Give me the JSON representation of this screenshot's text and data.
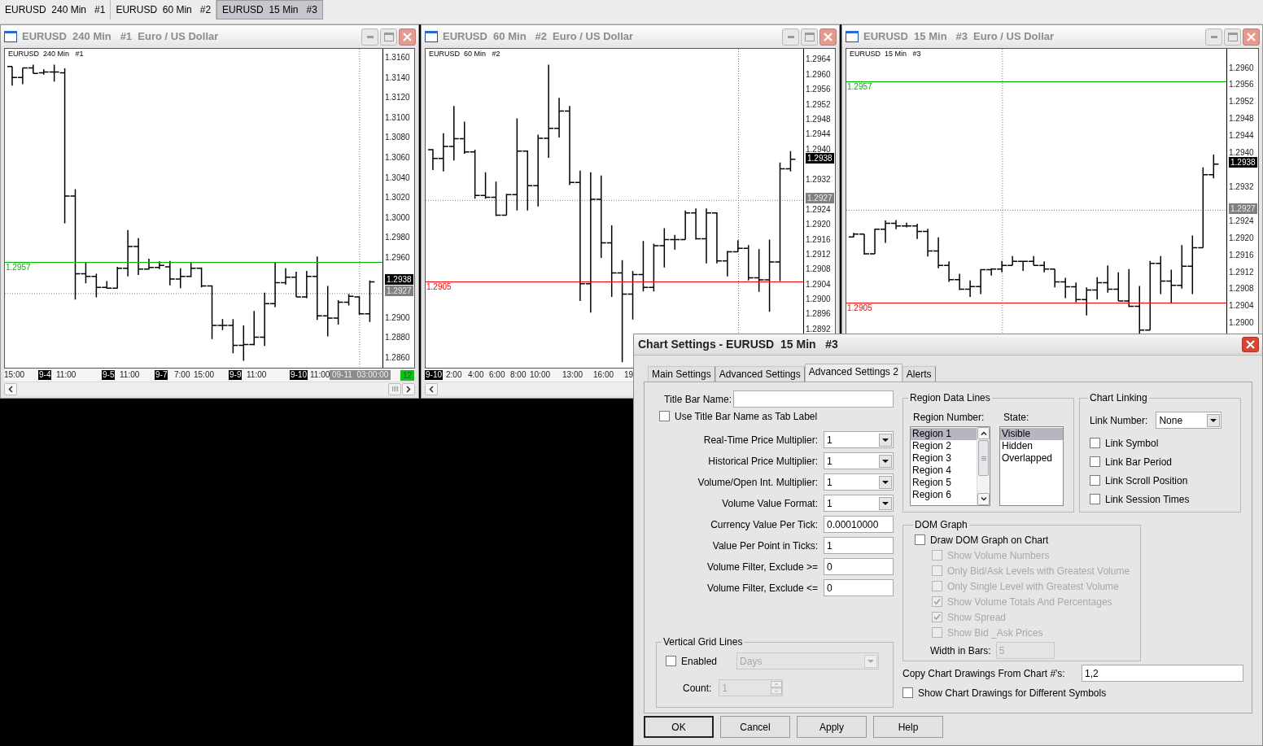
{
  "top_tabs": [
    {
      "label": "EURUSD  240 Min   #1",
      "selected": false
    },
    {
      "label": "EURUSD  60 Min   #2",
      "selected": false
    },
    {
      "label": "EURUSD  15 Min   #3",
      "selected": true
    }
  ],
  "windows": [
    {
      "title": "EURUSD  240 Min   #1  Euro / US Dollar",
      "chart_label": "EURUSD  240 Min   #1",
      "price_axis": [
        {
          "kind": "tick",
          "text": "1.3160"
        },
        {
          "kind": "tick",
          "text": "1.3140"
        },
        {
          "kind": "tick",
          "text": "1.3120"
        },
        {
          "kind": "tick",
          "text": "1.3100"
        },
        {
          "kind": "tick",
          "text": "1.3080"
        },
        {
          "kind": "tick",
          "text": "1.3060"
        },
        {
          "kind": "tick",
          "text": "1.3040"
        },
        {
          "kind": "tick",
          "text": "1.3020"
        },
        {
          "kind": "tick",
          "text": "1.3000"
        },
        {
          "kind": "tick",
          "text": "1.2980"
        },
        {
          "kind": "tick",
          "text": "1.2960"
        },
        {
          "kind": "last",
          "text": "1.2938"
        },
        {
          "kind": "cursor",
          "text": "1.2927"
        },
        {
          "kind": "tick",
          "text": "1.2900"
        },
        {
          "kind": "tick",
          "text": "1.2880"
        },
        {
          "kind": "tick",
          "text": "1.2860"
        }
      ],
      "level_lines": [
        {
          "price": "1.2957",
          "color": "#00b400"
        }
      ],
      "time_axis": [
        {
          "kind": "time",
          "text": "15:00"
        },
        {
          "kind": "date",
          "text": "9-4"
        },
        {
          "kind": "time",
          "text": "11:00"
        },
        {
          "kind": "date",
          "text": "9-5"
        },
        {
          "kind": "time",
          "text": "11:00"
        },
        {
          "kind": "date",
          "text": "9-7"
        },
        {
          "kind": "time",
          "text": "7:00"
        },
        {
          "kind": "time",
          "text": "15:00"
        },
        {
          "kind": "date",
          "text": "9-9"
        },
        {
          "kind": "time",
          "text": "11:00"
        },
        {
          "kind": "date",
          "text": "9-10"
        },
        {
          "kind": "time",
          "text": "11:00"
        },
        {
          "kind": "cursor",
          "text": "09-11  03:00:00"
        }
      ],
      "bar_counter": "12"
    },
    {
      "title": "EURUSD  60 Min   #2  Euro / US Dollar",
      "chart_label": "EURUSD  60 Min   #2",
      "price_axis": [
        {
          "kind": "tick",
          "text": "1.2964"
        },
        {
          "kind": "tick",
          "text": "1.2960"
        },
        {
          "kind": "tick",
          "text": "1.2956"
        },
        {
          "kind": "tick",
          "text": "1.2952"
        },
        {
          "kind": "tick",
          "text": "1.2948"
        },
        {
          "kind": "tick",
          "text": "1.2944"
        },
        {
          "kind": "tick",
          "text": "1.2940"
        },
        {
          "kind": "last",
          "text": "1.2938"
        },
        {
          "kind": "tick",
          "text": "1.2932"
        },
        {
          "kind": "cursor",
          "text": "1.2927"
        },
        {
          "kind": "tick",
          "text": "1.2924"
        },
        {
          "kind": "tick",
          "text": "1.2920"
        },
        {
          "kind": "tick",
          "text": "1.2916"
        },
        {
          "kind": "tick",
          "text": "1.2912"
        },
        {
          "kind": "tick",
          "text": "1.2908"
        },
        {
          "kind": "tick",
          "text": "1.2904"
        },
        {
          "kind": "tick",
          "text": "1.2900"
        },
        {
          "kind": "tick",
          "text": "1.2896"
        },
        {
          "kind": "tick",
          "text": "1.2892"
        }
      ],
      "level_lines": [
        {
          "price": "1.2905",
          "color": "#ff0000"
        }
      ],
      "time_axis": [
        {
          "kind": "date",
          "text": "9-10"
        },
        {
          "kind": "time",
          "text": "2:00"
        },
        {
          "kind": "time",
          "text": "4:00"
        },
        {
          "kind": "time",
          "text": "6:00"
        },
        {
          "kind": "time",
          "text": "8:00"
        },
        {
          "kind": "time",
          "text": "10:00"
        },
        {
          "kind": "time",
          "text": "13:00"
        },
        {
          "kind": "time",
          "text": "16:00"
        },
        {
          "kind": "time",
          "text": "19"
        }
      ]
    },
    {
      "title": "EURUSD  15 Min   #3  Euro / US Dollar",
      "chart_label": "EURUSD  15 Min   #3",
      "price_axis": [
        {
          "kind": "tick",
          "text": "1.2960"
        },
        {
          "kind": "tick",
          "text": "1.2956"
        },
        {
          "kind": "tick",
          "text": "1.2952"
        },
        {
          "kind": "tick",
          "text": "1.2948"
        },
        {
          "kind": "tick",
          "text": "1.2944"
        },
        {
          "kind": "tick",
          "text": "1.2940"
        },
        {
          "kind": "last",
          "text": "1.2938"
        },
        {
          "kind": "tick",
          "text": "1.2932"
        },
        {
          "kind": "cursor",
          "text": "1.2927"
        },
        {
          "kind": "tick",
          "text": "1.2924"
        },
        {
          "kind": "tick",
          "text": "1.2920"
        },
        {
          "kind": "tick",
          "text": "1.2916"
        },
        {
          "kind": "tick",
          "text": "1.2912"
        },
        {
          "kind": "tick",
          "text": "1.2908"
        },
        {
          "kind": "tick",
          "text": "1.2904"
        },
        {
          "kind": "tick",
          "text": "1.2900"
        }
      ],
      "level_lines": [
        {
          "price": "1.2957",
          "color": "#00b400"
        },
        {
          "price": "1.2905",
          "color": "#ff0000"
        }
      ]
    }
  ],
  "dialog": {
    "title": "Chart Settings - EURUSD  15 Min   #3",
    "tabs": [
      {
        "label": "Main Settings",
        "selected": false
      },
      {
        "label": "Advanced Settings",
        "selected": false
      },
      {
        "label": "Advanced Settings 2",
        "selected": true
      },
      {
        "label": "Alerts",
        "selected": false
      }
    ],
    "title_bar_name": {
      "label": "Title Bar Name:"
    },
    "use_title_as_tab": {
      "label": "Use Title Bar Name as Tab Label",
      "checked": false
    },
    "settings": [
      {
        "label": "Real-Time Price Multiplier:",
        "value": "1",
        "kind": "dropdown"
      },
      {
        "label": "Historical Price Multiplier:",
        "value": "1",
        "kind": "dropdown"
      },
      {
        "label": "Volume/Open Int. Multiplier:",
        "value": "1",
        "kind": "dropdown"
      },
      {
        "label": "Volume Value Format:",
        "value": "1",
        "kind": "dropdown"
      },
      {
        "label": "Currency Value Per Tick:",
        "value": "0.00010000",
        "kind": "text"
      },
      {
        "label": "Value Per Point in Ticks:",
        "value": "1",
        "kind": "text"
      },
      {
        "label": "Volume Filter, Exclude >=",
        "value": "0",
        "kind": "text"
      },
      {
        "label": "Volume Filter, Exclude <=",
        "value": "0",
        "kind": "text"
      }
    ],
    "vertical_grid_lines": {
      "title": "Vertical Grid Lines",
      "enabled": {
        "label": "Enabled",
        "checked": false
      },
      "unit": {
        "value": "Days",
        "disabled": true
      },
      "count": {
        "label": "Count:",
        "value": "1",
        "disabled": true
      }
    },
    "region_data_lines": {
      "title": "Region Data Lines",
      "region_label": "Region Number:",
      "state_label": "State:",
      "regions": [
        {
          "label": "Region 1",
          "selected": true
        },
        {
          "label": "Region 2",
          "selected": false
        },
        {
          "label": "Region 3",
          "selected": false
        },
        {
          "label": "Region 4",
          "selected": false
        },
        {
          "label": "Region 5",
          "selected": false
        },
        {
          "label": "Region 6",
          "selected": false
        }
      ],
      "states": [
        {
          "label": "Visible",
          "selected": true
        },
        {
          "label": "Hidden",
          "selected": false
        },
        {
          "label": "Overlapped",
          "selected": false
        }
      ]
    },
    "chart_linking": {
      "title": "Chart Linking",
      "link_number": {
        "label": "Link Number:",
        "value": "None"
      },
      "options": [
        {
          "label": "Link Symbol",
          "checked": false
        },
        {
          "label": "Link Bar Period",
          "checked": false
        },
        {
          "label": "Link Scroll Position",
          "checked": false
        },
        {
          "label": "Link Session Times",
          "checked": false
        }
      ]
    },
    "dom_graph": {
      "title": "DOM Graph",
      "draw": {
        "label": "Draw DOM Graph on Chart",
        "checked": false
      },
      "options": [
        {
          "label": "Show Volume Numbers",
          "checked": false,
          "disabled": true
        },
        {
          "label": "Only Bid/Ask Levels with Greatest Volume",
          "checked": false,
          "disabled": true
        },
        {
          "label": "Only Single Level with Greatest Volume",
          "checked": false,
          "disabled": true
        },
        {
          "label": "Show Volume Totals And Percentages",
          "checked": true,
          "disabled": true
        },
        {
          "label": "Show Spread",
          "checked": true,
          "disabled": true
        },
        {
          "label": "Show Bid _Ask Prices",
          "checked": false,
          "disabled": true
        }
      ],
      "width": {
        "label": "Width in Bars:",
        "value": "5",
        "disabled": true
      }
    },
    "copy_drawings": {
      "label": "Copy Chart Drawings From Chart #'s:",
      "value": "1,2"
    },
    "show_different_symbols": {
      "label": "Show Chart Drawings for Different Symbols",
      "checked": false
    },
    "buttons": [
      {
        "label": "OK",
        "default": true
      },
      {
        "label": "Cancel",
        "default": false
      },
      {
        "label": "Apply",
        "default": false
      },
      {
        "label": "Help",
        "default": false
      }
    ]
  }
}
